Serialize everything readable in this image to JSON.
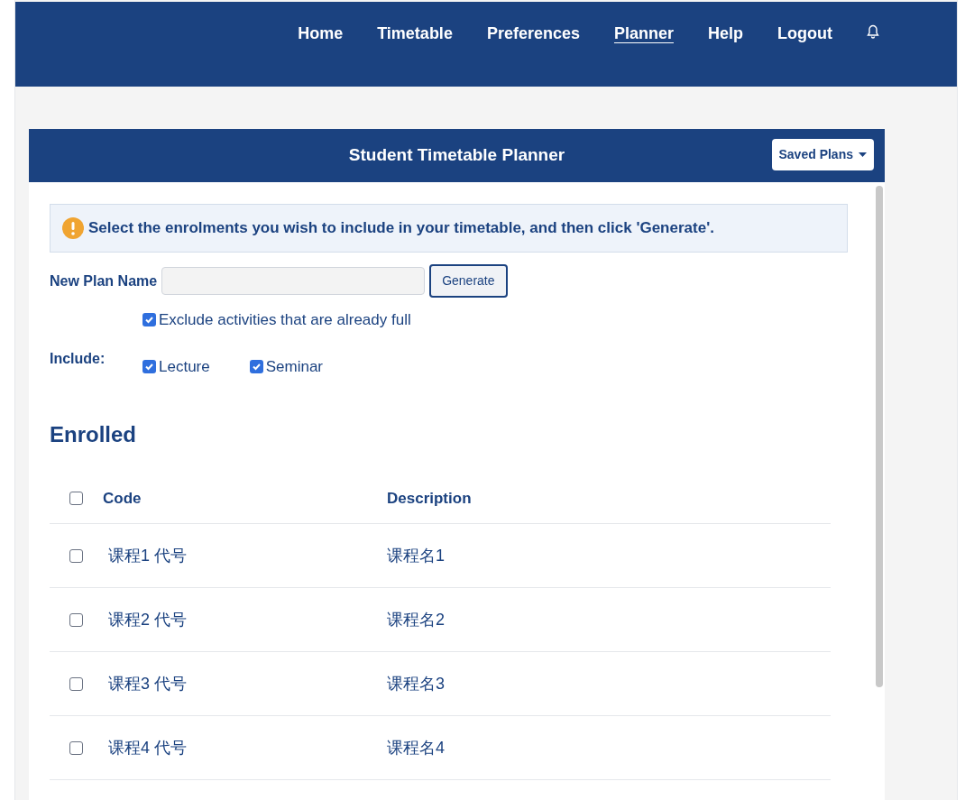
{
  "nav": {
    "links": [
      {
        "label": "Home",
        "selected": false
      },
      {
        "label": "Timetable",
        "selected": false
      },
      {
        "label": "Preferences",
        "selected": false
      },
      {
        "label": "Planner",
        "selected": true
      },
      {
        "label": "Help",
        "selected": false
      },
      {
        "label": "Logout",
        "selected": false
      }
    ]
  },
  "card": {
    "title": "Student Timetable Planner",
    "saved_plans": "Saved Plans"
  },
  "alert": "Select the enrolments you wish to include in your timetable, and then click 'Generate'.",
  "plan_name": {
    "label": "New Plan Name",
    "button": "Generate"
  },
  "exclude_full": {
    "label": "Exclude activities that are already full",
    "checked": true
  },
  "include": {
    "label": "Include:",
    "options": [
      {
        "label": "Lecture",
        "checked": true
      },
      {
        "label": "Seminar",
        "checked": true
      }
    ]
  },
  "enrolled": {
    "heading": "Enrolled",
    "select_all_checked": false,
    "columns": [
      "Code",
      "Description"
    ],
    "rows": [
      {
        "code": "课程1 代号",
        "description": "课程名1",
        "checked": false
      },
      {
        "code": "课程2 代号",
        "description": "课程名2",
        "checked": false
      },
      {
        "code": "课程3 代号",
        "description": "课程名3",
        "checked": false
      },
      {
        "code": "课程4 代号",
        "description": "课程名4",
        "checked": false
      }
    ]
  }
}
